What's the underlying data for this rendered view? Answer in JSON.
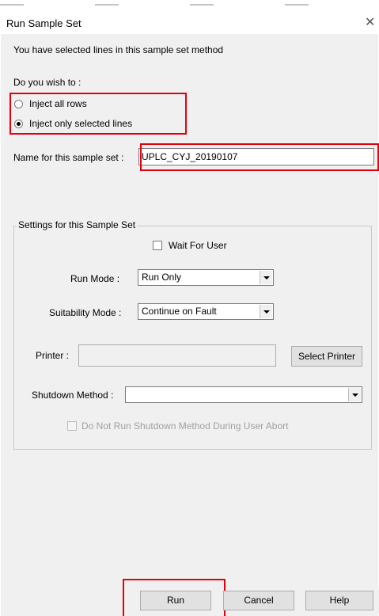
{
  "window": {
    "title": "Run Sample Set",
    "close_glyph": "✕"
  },
  "intro_text": "You have selected lines in this sample set method",
  "choice": {
    "question": "Do you wish to :",
    "options": [
      {
        "label": "Inject all rows",
        "checked": false
      },
      {
        "label": "Inject only selected lines",
        "checked": true
      }
    ]
  },
  "name_field": {
    "label": "Name for this sample set :",
    "value": "UPLC_CYJ_20190107"
  },
  "settings": {
    "group_title": "Settings for this Sample Set",
    "wait_for_user": {
      "label": "Wait For User",
      "checked": false
    },
    "run_mode": {
      "label": "Run Mode :",
      "value": "Run Only"
    },
    "suitability_mode": {
      "label": "Suitability Mode :",
      "value": "Continue on Fault"
    },
    "printer": {
      "label": "Printer :",
      "value": "",
      "button": "Select Printer"
    },
    "shutdown_method": {
      "label": "Shutdown Method :",
      "value": ""
    },
    "no_shutdown_on_abort": {
      "label": "Do Not Run Shutdown Method During User Abort",
      "checked": false,
      "enabled": false
    }
  },
  "buttons": {
    "run": "Run",
    "cancel": "Cancel",
    "help": "Help"
  },
  "colors": {
    "highlight": "#e3000f",
    "dialog_bg": "#f0f0f0"
  }
}
